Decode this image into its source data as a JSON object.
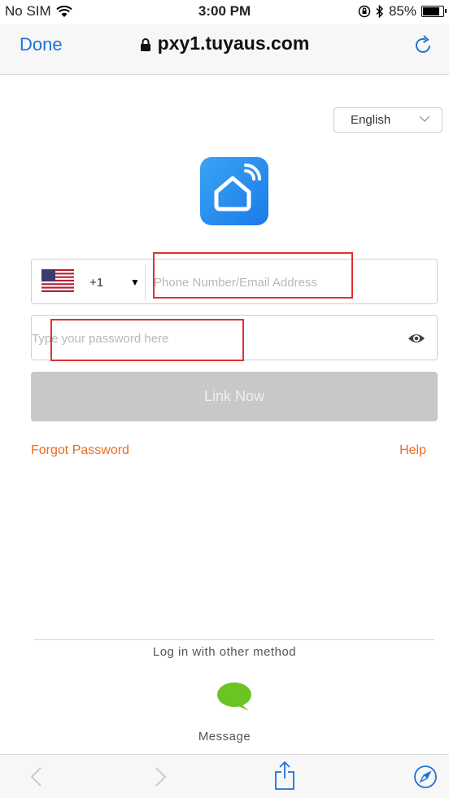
{
  "status_bar": {
    "carrier": "No SIM",
    "time": "3:00 PM",
    "battery": "85%",
    "battery_level": 0.85
  },
  "nav": {
    "done_label": "Done",
    "url": "pxy1.tuyaus.com"
  },
  "language": {
    "selected": "English"
  },
  "login": {
    "country_code": "+1",
    "phone_placeholder": "Phone Number/Email Address",
    "password_placeholder": "Type your password here",
    "submit_label": "Link Now",
    "forgot_label": "Forgot Password",
    "help_label": "Help"
  },
  "other_login": {
    "heading": "Log in with other method",
    "message_label": "Message"
  },
  "colors": {
    "accent_blue": "#1e73d6",
    "link_orange": "#f06a1e",
    "button_disabled": "#c8c8c8",
    "message_green": "#6cc324",
    "annotation_red": "#e03030"
  },
  "icons": {
    "wifi": "wifi-icon",
    "lock": "lock-icon",
    "reload": "reload-icon",
    "flag": "us-flag-icon",
    "eye": "eye-icon",
    "message": "message-bubble-icon",
    "back": "back-chevron-icon",
    "forward": "forward-chevron-icon",
    "share": "share-icon",
    "safari": "compass-icon"
  }
}
